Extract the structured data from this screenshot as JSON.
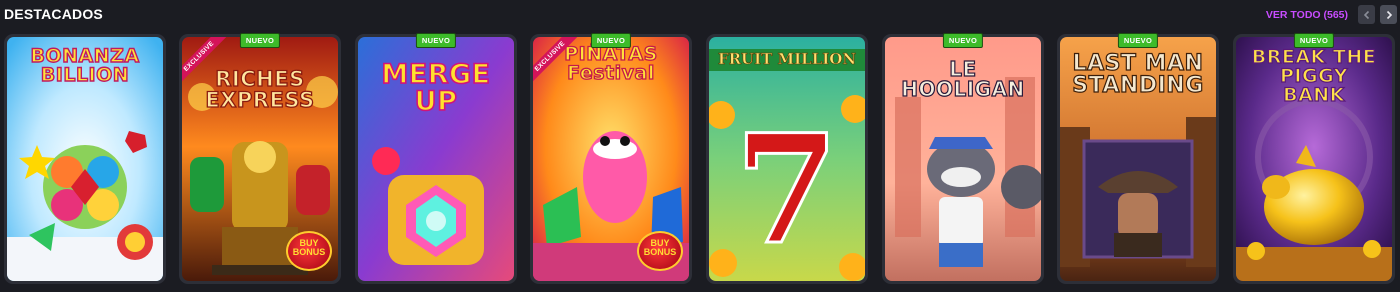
{
  "header": {
    "title": "DESTACADOS",
    "view_all_label": "VER TODO (565)"
  },
  "badges": {
    "new": "NUEVO",
    "exclusive": "EXCLUSIVE"
  },
  "games": [
    {
      "title": "BONANZA BILLION",
      "is_new": false,
      "is_exclusive": false,
      "buy_bonus": ""
    },
    {
      "title": "RICHES EXPRESS",
      "is_new": true,
      "is_exclusive": true,
      "buy_bonus": "BUY BONUS"
    },
    {
      "title": "MERGE UP",
      "is_new": true,
      "is_exclusive": false,
      "buy_bonus": ""
    },
    {
      "title": "PIÑATAS Festival",
      "is_new": true,
      "is_exclusive": true,
      "buy_bonus": "BUY BONUS"
    },
    {
      "title": "FRUIT MILLION",
      "is_new": false,
      "is_exclusive": false,
      "buy_bonus": "",
      "symbol": "7"
    },
    {
      "title": "LE HOOLIGAN",
      "is_new": true,
      "is_exclusive": false,
      "buy_bonus": ""
    },
    {
      "title": "LAST MAN STANDING",
      "is_new": true,
      "is_exclusive": false,
      "buy_bonus": ""
    },
    {
      "title": "BREAK THE PIGGY BANK",
      "is_new": true,
      "is_exclusive": false,
      "buy_bonus": ""
    }
  ],
  "colors": {
    "background": "#1b1c22",
    "accent": "#c84cff",
    "new_badge": "#3dbb2a",
    "exclusive_badge": "#d4145a"
  }
}
